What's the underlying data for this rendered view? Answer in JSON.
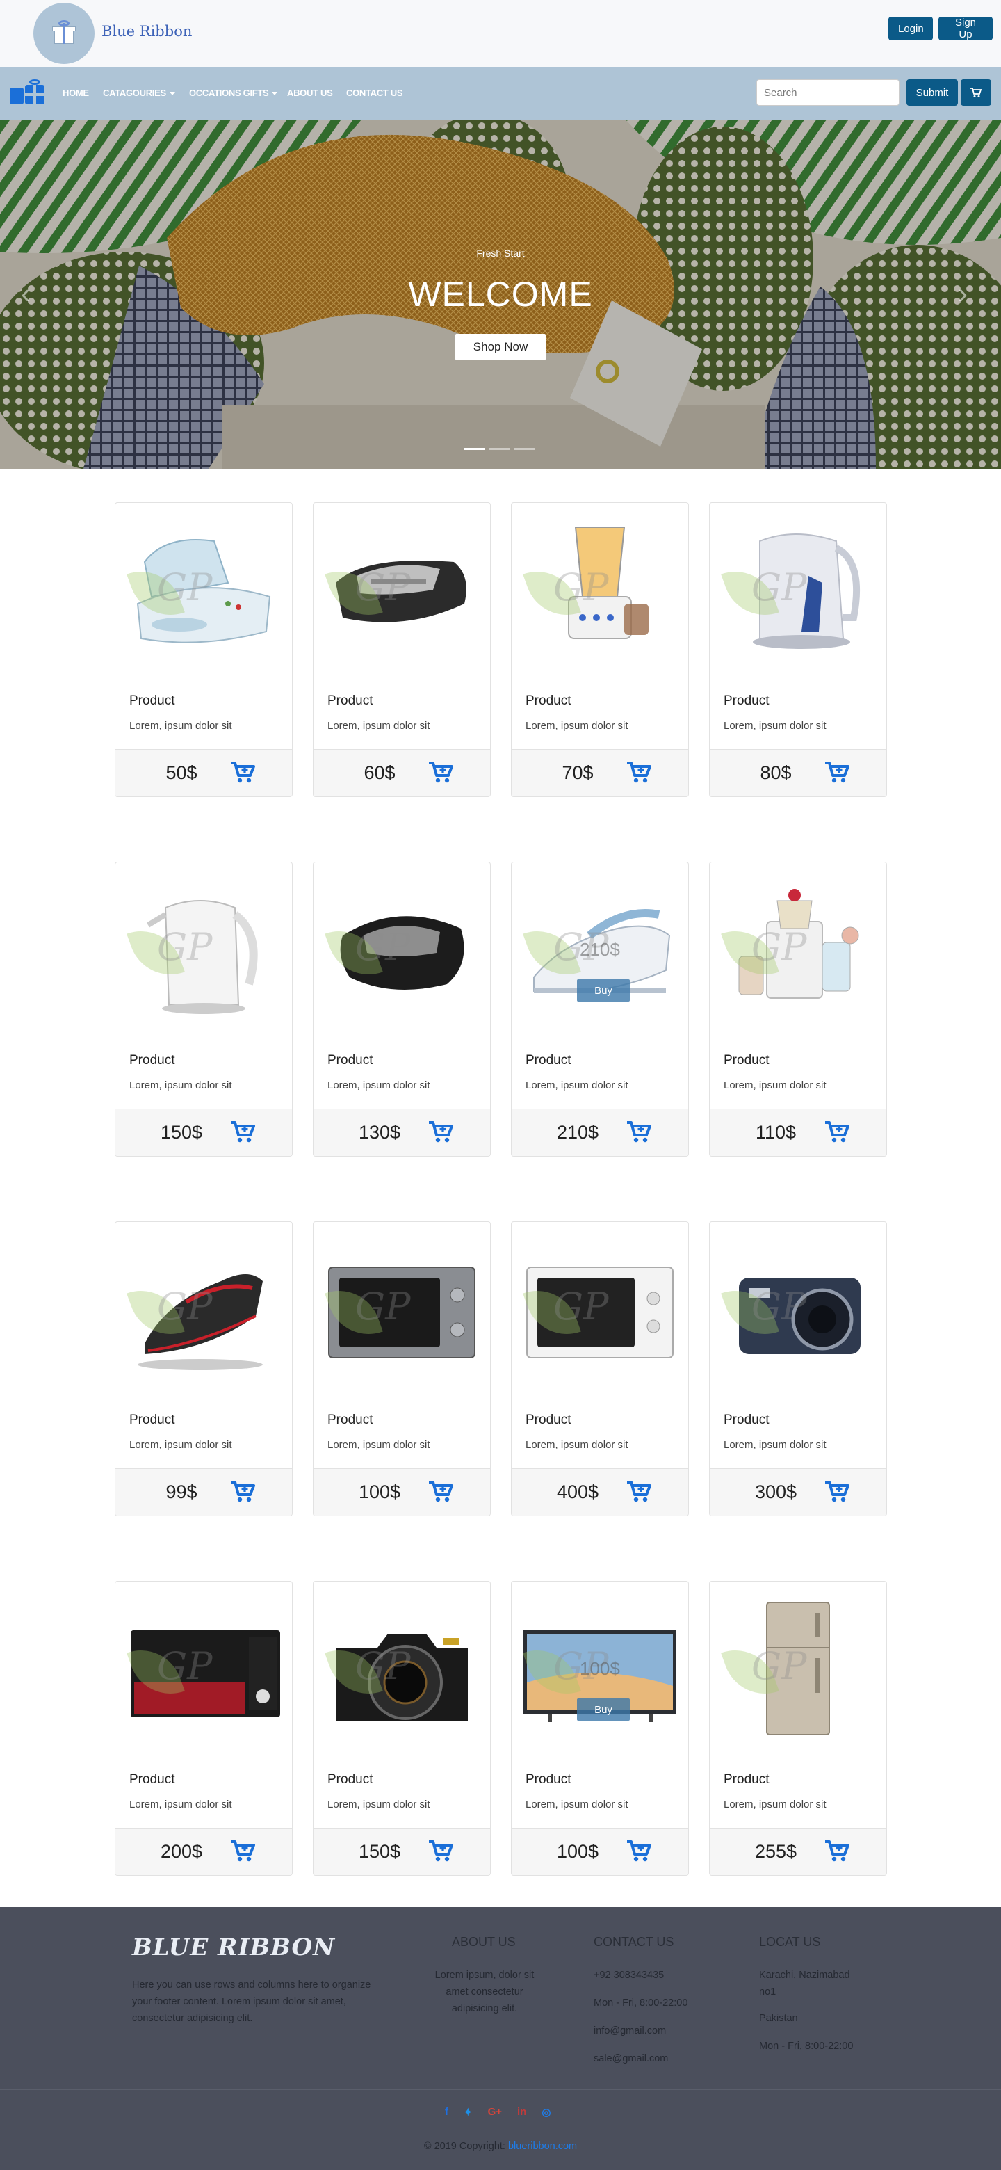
{
  "header": {
    "brand": "Blue Ribbon",
    "login_label": "Login",
    "signup_label": "Sign Up"
  },
  "nav": {
    "items": [
      {
        "label": "HOME",
        "dropdown": false
      },
      {
        "label": "CATAGOURIES",
        "dropdown": true
      },
      {
        "label": "OCCATIONS GIFTS",
        "dropdown": true
      },
      {
        "label": "ABOUT US",
        "dropdown": false
      },
      {
        "label": "CONTACT US",
        "dropdown": false
      }
    ],
    "search_placeholder": "Search",
    "submit_label": "Submit",
    "cart_icon": "cart-icon"
  },
  "hero": {
    "eyebrow": "Fresh Start",
    "title": "WELCOME",
    "button_label": "Shop Now",
    "slides": 3,
    "active_slide": 1
  },
  "products": [
    {
      "name": "Product",
      "desc": "Lorem, ipsum dolor sit",
      "price": "50$",
      "kind": "sandwich-maker"
    },
    {
      "name": "Product",
      "desc": "Lorem, ipsum dolor sit",
      "price": "60$",
      "kind": "grill-maker"
    },
    {
      "name": "Product",
      "desc": "Lorem, ipsum dolor sit",
      "price": "70$",
      "kind": "blender"
    },
    {
      "name": "Product",
      "desc": "Lorem, ipsum dolor sit",
      "price": "80$",
      "kind": "kettle"
    },
    {
      "name": "Product",
      "desc": "Lorem, ipsum dolor sit",
      "price": "150$",
      "kind": "kettle-white"
    },
    {
      "name": "Product",
      "desc": "Lorem, ipsum dolor sit",
      "price": "130$",
      "kind": "sandwich-black"
    },
    {
      "name": "Product",
      "desc": "Lorem, ipsum dolor sit",
      "price": "210$",
      "kind": "steam-iron",
      "overlay_price": "210$",
      "overlay_buy": "Buy"
    },
    {
      "name": "Product",
      "desc": "Lorem, ipsum dolor sit",
      "price": "110$",
      "kind": "food-processor"
    },
    {
      "name": "Product",
      "desc": "Lorem, ipsum dolor sit",
      "price": "99$",
      "kind": "iron-red"
    },
    {
      "name": "Product",
      "desc": "Lorem, ipsum dolor sit",
      "price": "100$",
      "kind": "microwave-silver"
    },
    {
      "name": "Product",
      "desc": "Lorem, ipsum dolor sit",
      "price": "400$",
      "kind": "microwave-white"
    },
    {
      "name": "Product",
      "desc": "Lorem, ipsum dolor sit",
      "price": "300$",
      "kind": "camera-compact"
    },
    {
      "name": "Product",
      "desc": "Lorem, ipsum dolor sit",
      "price": "200$",
      "kind": "microwave-red"
    },
    {
      "name": "Product",
      "desc": "Lorem, ipsum dolor sit",
      "price": "150$",
      "kind": "camera-dslr"
    },
    {
      "name": "Product",
      "desc": "Lorem, ipsum dolor sit",
      "price": "100$",
      "kind": "television",
      "overlay_price": "100$",
      "overlay_buy": "Buy"
    },
    {
      "name": "Product",
      "desc": "Lorem, ipsum dolor sit",
      "price": "255$",
      "kind": "refrigerator"
    }
  ],
  "footer": {
    "brand": "BLUE RIBBON",
    "about_text": "Here you can use rows and columns here to organize your footer content. Lorem ipsum dolor sit amet, consectetur adipisicing elit.",
    "about_head": "ABOUT US",
    "about_body": "Lorem ipsum, dolor sit amet consectetur adipisicing elit.",
    "contact_head": "CONTACT US",
    "contact_lines": [
      "+92 308343435",
      "Mon - Fri, 8:00-22:00",
      "info@gmail.com",
      "sale@gmail.com"
    ],
    "location_head": "LOCAT US",
    "location_lines": [
      "Karachi, Nazimabad no1",
      "Pakistan",
      "Mon - Fri, 8:00-22:00"
    ],
    "socials": [
      {
        "icon": "facebook-icon",
        "glyph": "f",
        "color": "#1e6fe0"
      },
      {
        "icon": "twitter-icon",
        "glyph": "✦",
        "color": "#1e90e8"
      },
      {
        "icon": "google-plus-icon",
        "glyph": "G+",
        "color": "#d8453a"
      },
      {
        "icon": "linkedin-icon",
        "glyph": "in",
        "color": "#c23b3b"
      },
      {
        "icon": "instagram-icon",
        "glyph": "◎",
        "color": "#1e7ce8"
      }
    ],
    "copyright_prefix": "© 2019 Copyright:",
    "copyright_link": "blueribbon.com"
  },
  "colors": {
    "primary_button": "#0b5a88",
    "nav_bg": "#aec4d6",
    "cart_blue": "#1b6fd8",
    "footer_bg": "#4b4f5c"
  }
}
